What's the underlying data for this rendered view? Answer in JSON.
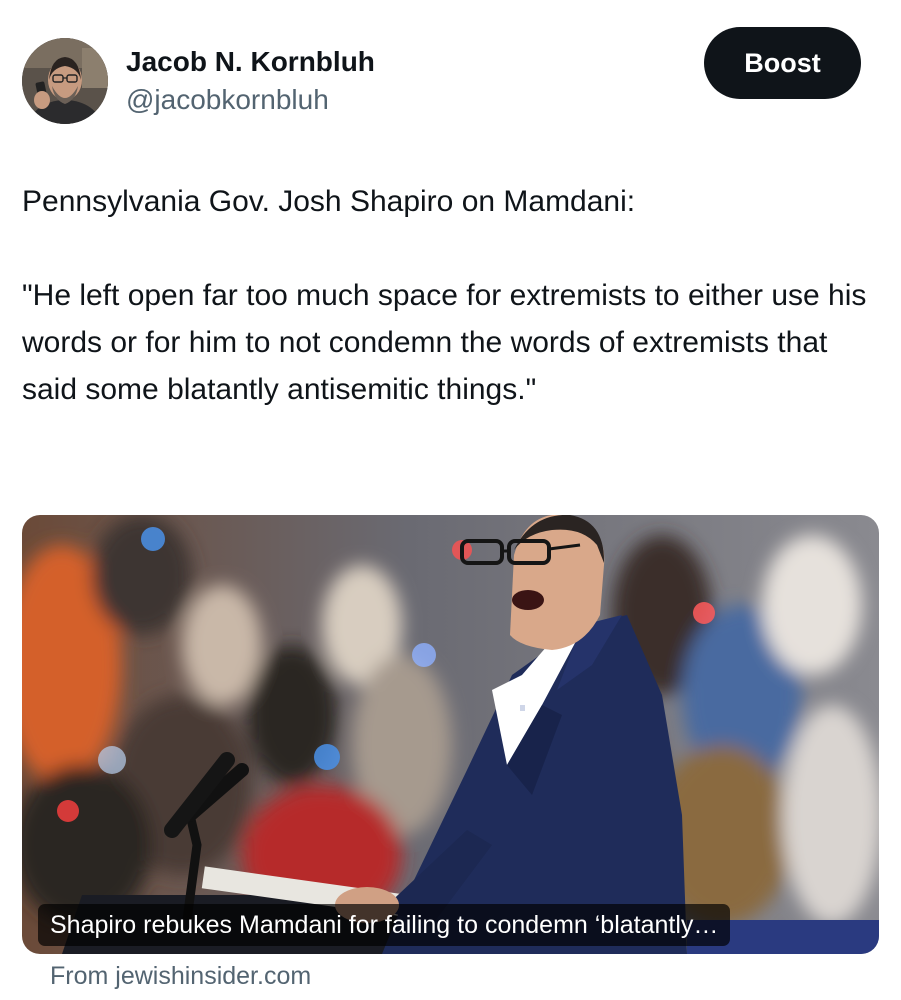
{
  "author": {
    "name": "Jacob N. Kornbluh",
    "handle": "@jacobkornbluh"
  },
  "actions": {
    "boost_label": "Boost"
  },
  "tweet": {
    "lines": [
      "Pennsylvania Gov. Josh Shapiro on Mamdani:",
      "\"He left open far too much space for extremists to either use his words or for him to not condemn the words of extremists that said some blatantly antisemitic things.\""
    ]
  },
  "link_card": {
    "caption": "Shapiro rebukes Mamdani for failing to condemn ‘blatantly…",
    "source": "From jewishinsider.com"
  },
  "colors": {
    "text_primary": "#0f1419",
    "text_secondary": "#536471",
    "boost_bg": "#0f1419",
    "suit_navy": "#1f2c5a"
  },
  "icons": {
    "avatar": "profile-photo",
    "card_image": "speaker-at-podium-photo"
  }
}
